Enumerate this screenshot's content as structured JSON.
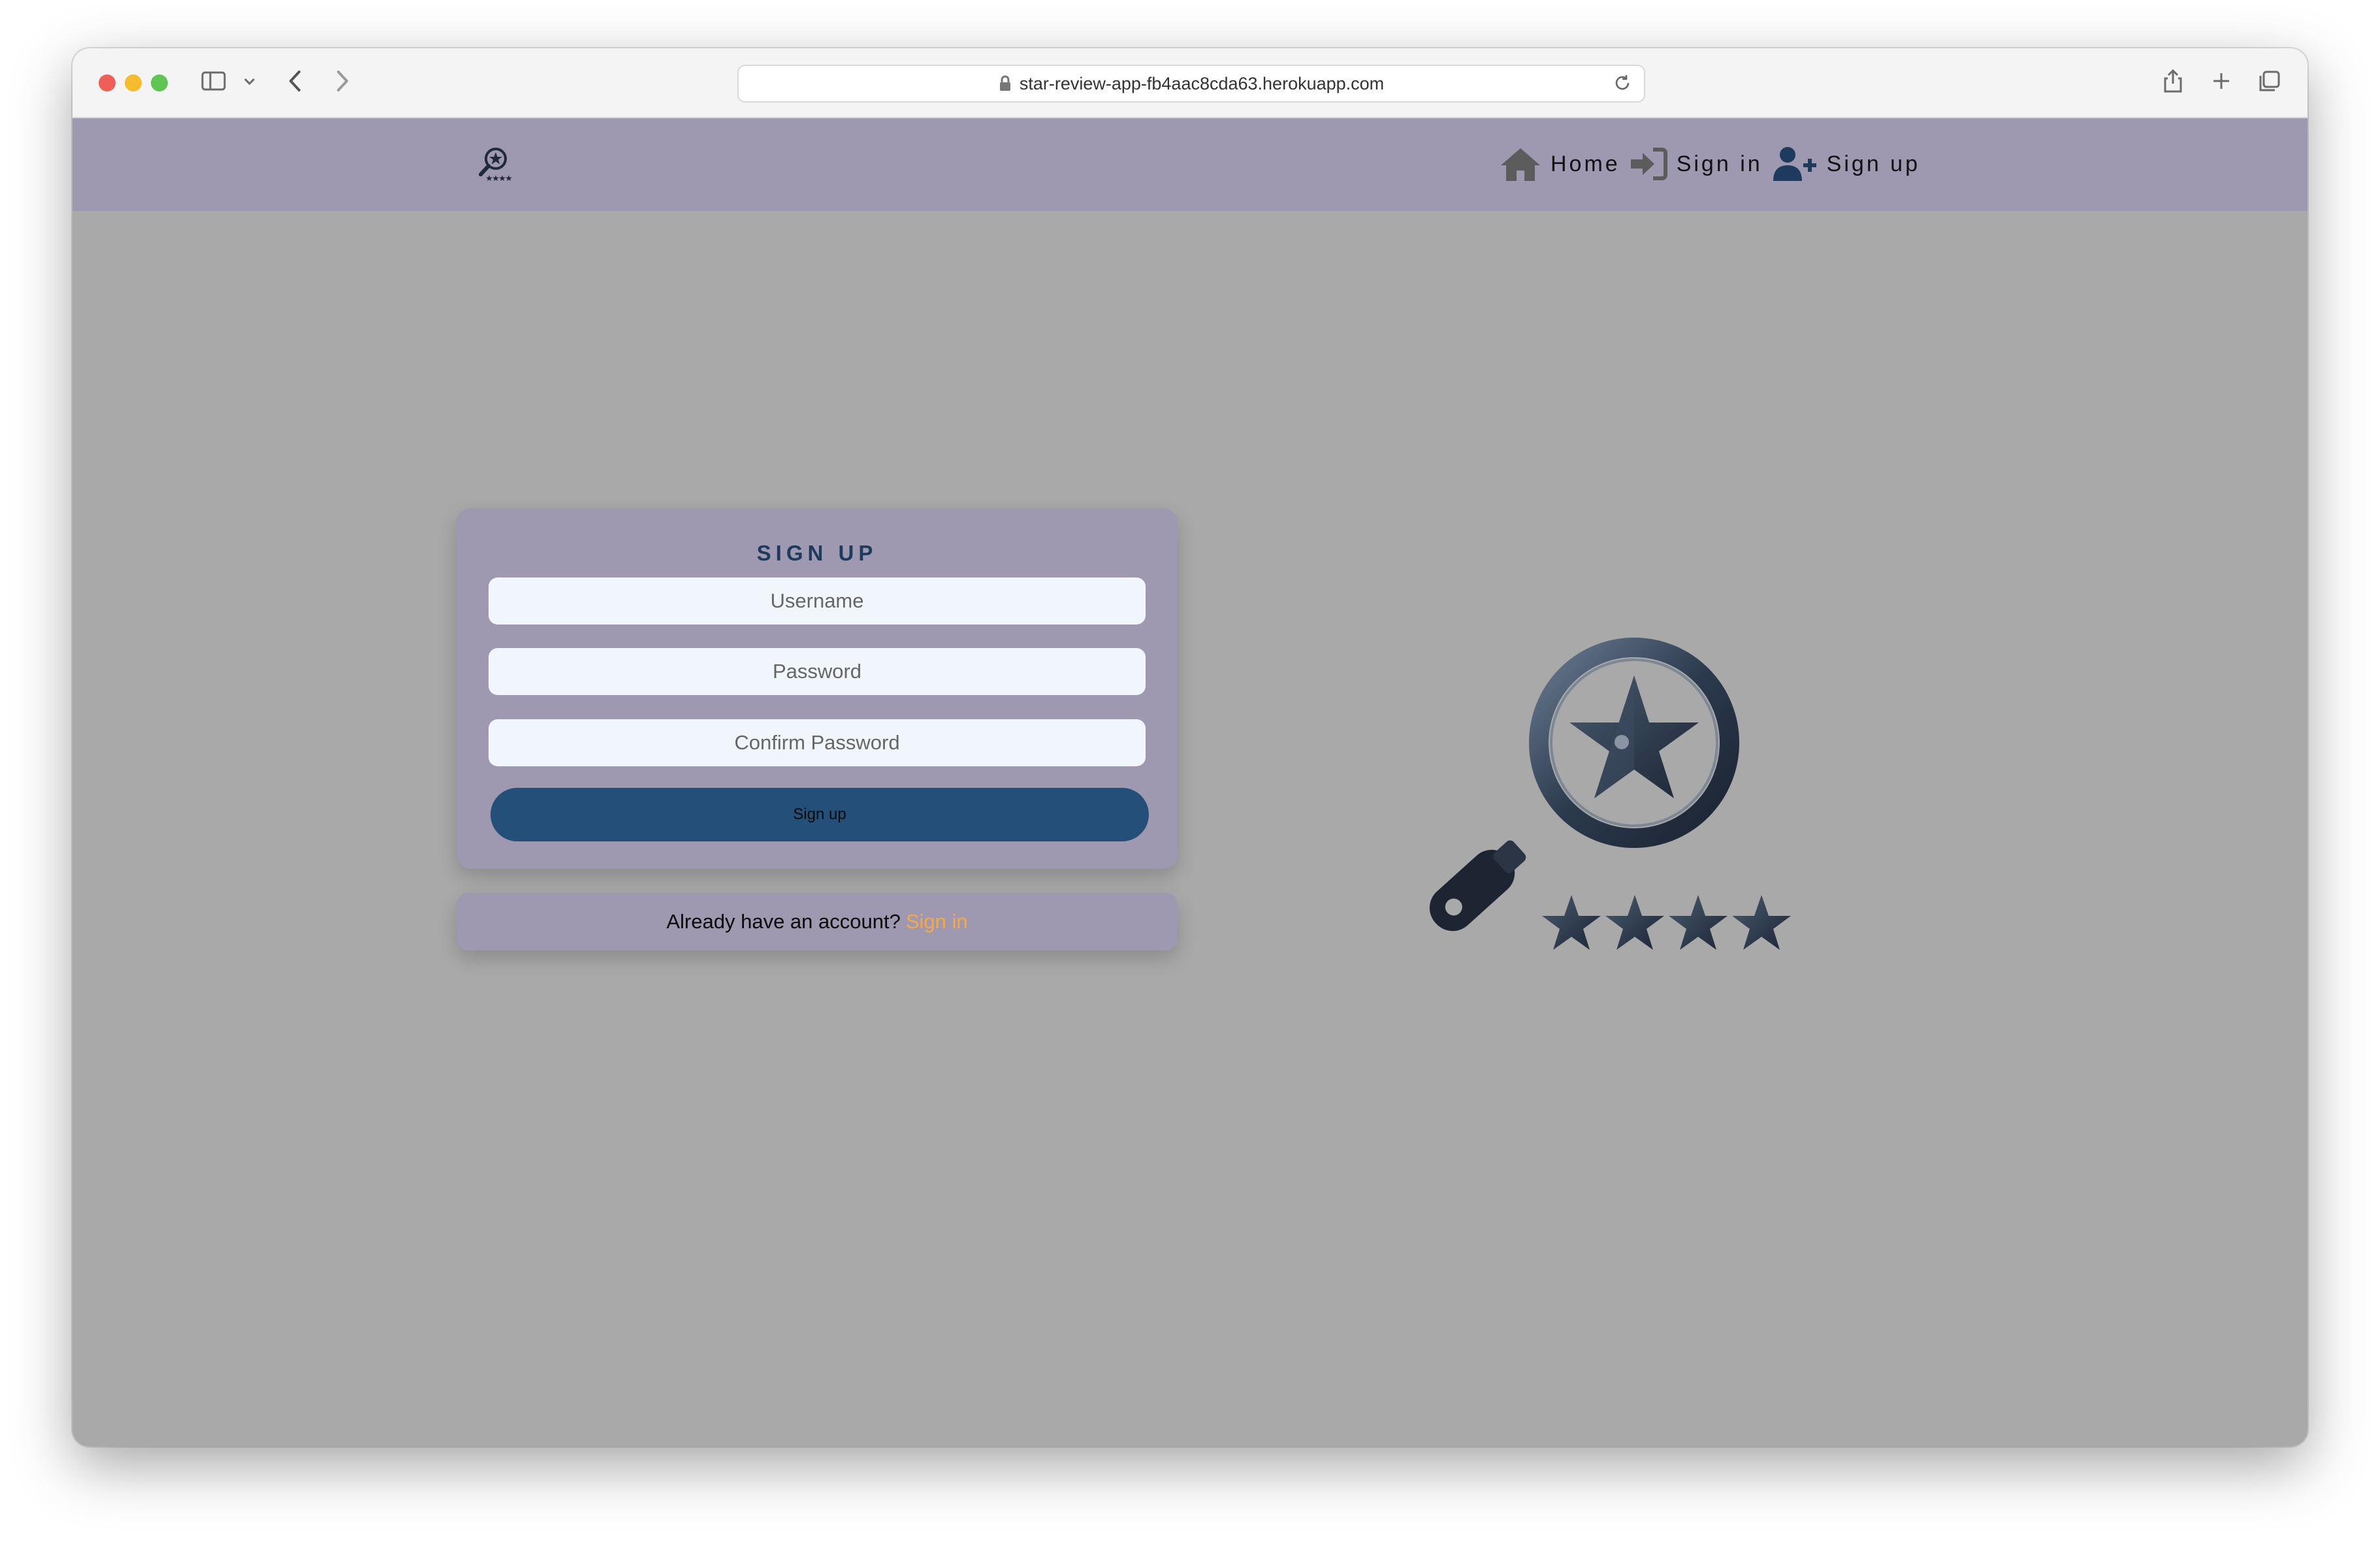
{
  "browser": {
    "url": "star-review-app-fb4aac8cda63.herokuapp.com"
  },
  "navbar": {
    "brand_icon": "magnifier-star-logo",
    "links": [
      {
        "label": "Home",
        "icon": "home-icon"
      },
      {
        "label": "Sign in",
        "icon": "sign-in-icon"
      },
      {
        "label": "Sign up",
        "icon": "user-plus-icon"
      }
    ]
  },
  "signup_form": {
    "title": "SIGN UP",
    "username_placeholder": "Username",
    "password_placeholder": "Password",
    "confirm_password_placeholder": "Confirm Password",
    "submit_label": "Sign up"
  },
  "signin_prompt": {
    "text": "Already have an account?",
    "link_label": "Sign in"
  },
  "colors": {
    "navbar_bg": "#9e98b0",
    "page_bg": "#a9a9a9",
    "card_bg": "#9e98b0",
    "button_bg": "#234f78",
    "title_color": "#1e3a5c",
    "link_color": "#f6a84a"
  }
}
